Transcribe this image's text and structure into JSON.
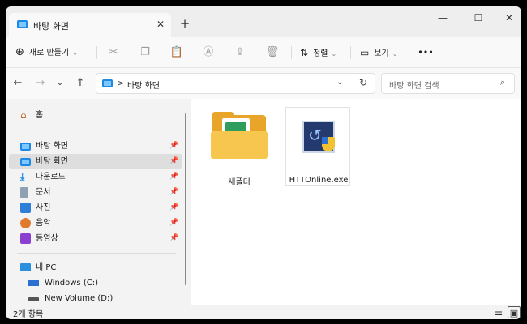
{
  "window": {
    "tab_title": "바탕 화면",
    "tab_close_glyph": "✕",
    "new_tab_glyph": "+",
    "minimize_glyph": "—",
    "maximize_glyph": "☐",
    "close_glyph": "✕"
  },
  "toolbar": {
    "new_label": "새로 만들기",
    "new_icon": "plus-circle-icon",
    "new_glyph": "⊕",
    "cut_glyph": "✂",
    "copy_glyph": "❐",
    "paste_glyph": "📋",
    "rename_glyph": "Ⓐ",
    "share_glyph": "⇪",
    "delete_glyph": "🗑",
    "sort_label": "정렬",
    "sort_glyph": "⇅",
    "view_label": "보기",
    "view_glyph": "▭",
    "chevron_glyph": "⌄",
    "more_glyph": "•••"
  },
  "navigation": {
    "back_glyph": "←",
    "forward_glyph": "→",
    "recent_glyph": "⌄",
    "up_glyph": "↑"
  },
  "address": {
    "separator": ">",
    "path": "바탕 화면",
    "dropdown_glyph": "⌄",
    "refresh_glyph": "↻"
  },
  "search": {
    "placeholder": "바탕 화면 검색",
    "icon_glyph": "⌕"
  },
  "sidebar": {
    "pin_glyph": "📌",
    "items": [
      {
        "label": "홈",
        "icon": "home-icon",
        "glyph": "⌂"
      },
      {
        "label": "바탕 화면",
        "icon": "desktop-icon",
        "pinned": true
      },
      {
        "label": "바탕 화면",
        "icon": "desktop-icon",
        "pinned": true,
        "selected": true
      },
      {
        "label": "다운로드",
        "icon": "download-icon",
        "glyph": "⤓",
        "pinned": true
      },
      {
        "label": "문서",
        "icon": "documents-icon",
        "pinned": true
      },
      {
        "label": "사진",
        "icon": "pictures-icon",
        "pinned": true
      },
      {
        "label": "음악",
        "icon": "music-icon",
        "pinned": true
      },
      {
        "label": "동영상",
        "icon": "videos-icon",
        "pinned": true
      },
      {
        "label": "내 PC",
        "icon": "this-pc-icon"
      },
      {
        "label": "Windows (C:)",
        "icon": "drive-c-icon"
      },
      {
        "label": "New Volume (D:)",
        "icon": "drive-d-icon"
      }
    ]
  },
  "files": [
    {
      "name": "새폴더",
      "icon": "folder-icon"
    },
    {
      "name": "HTTOnline.exe",
      "icon": "exe-app-icon"
    }
  ],
  "status": {
    "item_count": "2개 항목",
    "details_view_glyph": "☰",
    "tiles_view_glyph": "▣"
  }
}
